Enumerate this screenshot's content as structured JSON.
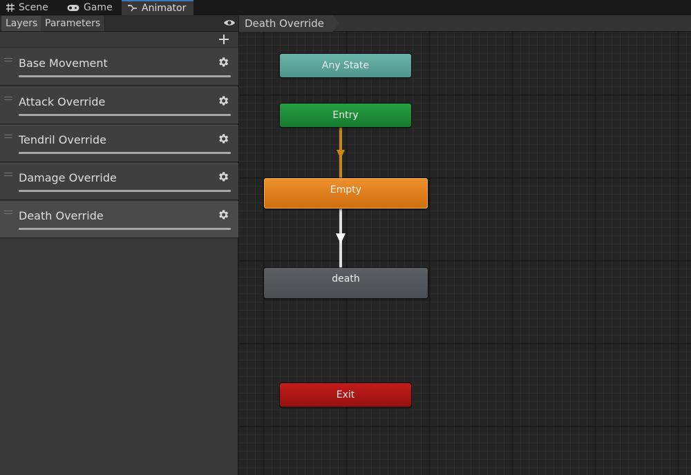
{
  "tabs": [
    {
      "label": "Scene",
      "icon": "grid-icon"
    },
    {
      "label": "Game",
      "icon": "gamepad-icon"
    },
    {
      "label": "Animator",
      "icon": "animator-icon",
      "active": true
    }
  ],
  "left_panel": {
    "subtabs": [
      {
        "label": "Layers",
        "active": true
      },
      {
        "label": "Parameters"
      }
    ],
    "eye_icon": "eye-icon",
    "add_icon": "plus-icon",
    "layers": [
      {
        "label": "Base Movement"
      },
      {
        "label": "Attack Override"
      },
      {
        "label": "Tendril Override"
      },
      {
        "label": "Damage Override"
      },
      {
        "label": "Death Override",
        "selected": true
      }
    ]
  },
  "breadcrumb": {
    "label": "Death Override"
  },
  "graph": {
    "states": {
      "any_state": "Any State",
      "entry": "Entry",
      "empty": "Empty",
      "death": "death",
      "exit": "Exit"
    },
    "colors": {
      "any_state": "#5ba89c",
      "entry": "#1e8c38",
      "empty": "#e0801e",
      "death": "#53565b",
      "exit": "#ab1616",
      "default_transition": "#c8890c",
      "transition": "#e0e0e0"
    }
  }
}
